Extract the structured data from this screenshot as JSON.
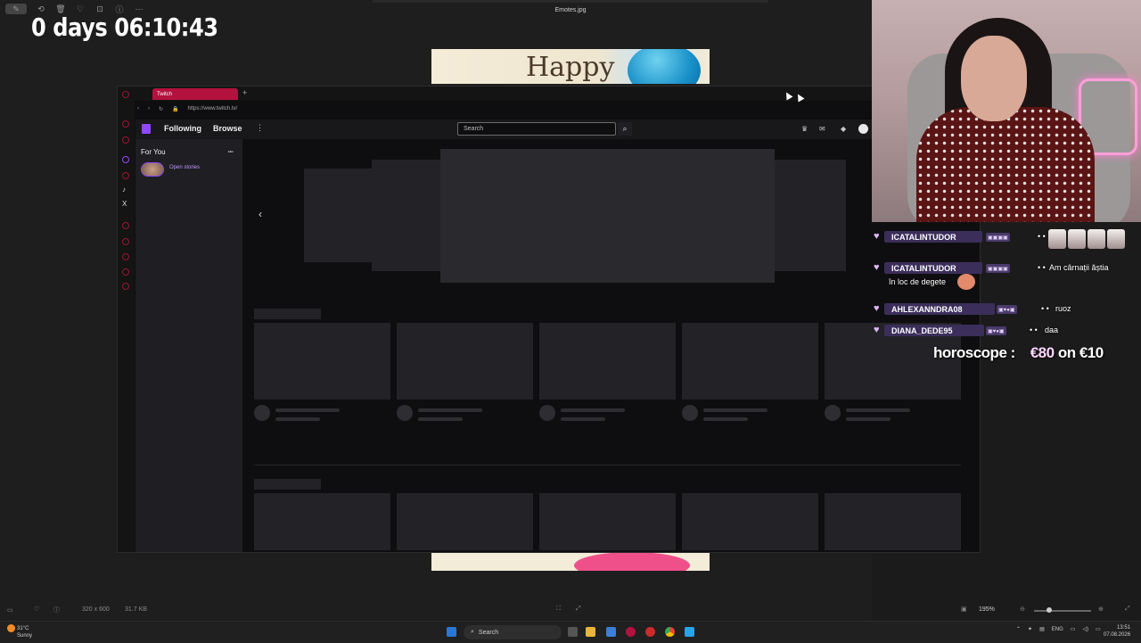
{
  "viewer": {
    "filename": "Emotes.jpg",
    "image_text": "Happy",
    "bottom": {
      "dimensions": "320 x 600",
      "filesize": "31.7 KB",
      "zoom": "195%"
    }
  },
  "stream": {
    "timer": "0 days 06:10:43",
    "horoscope": {
      "label": "horoscope :",
      "current": "€80",
      "sep": "on",
      "goal": "€10"
    }
  },
  "browser": {
    "tab_title": "Twitch",
    "url": "https://www.twitch.tv/",
    "nav": {
      "following": "Following",
      "browse": "Browse",
      "more": "⋮"
    },
    "search_placeholder": "Search",
    "sidebar": {
      "for_you": "For You",
      "open_stories": "Open stories",
      "collapse": "⭰"
    },
    "carousel_prev": "‹"
  },
  "chat": {
    "messages": [
      {
        "user": "ICATALINTUDOR",
        "text": ""
      },
      {
        "user": "ICATALINTUDOR",
        "text": "Am cârnații ăștia",
        "text2": "în loc de degete"
      },
      {
        "user": "AHLEXANNDRA08",
        "text": "ruoz"
      },
      {
        "user": "DIANA_DEDE95",
        "text": "daa"
      }
    ]
  },
  "taskbar": {
    "weather_temp": "31°C",
    "weather_desc": "Sunny",
    "search": "Search",
    "lang": "ENG",
    "time": "13:51",
    "date": "07.08.2026"
  },
  "colors": {
    "twitch_purple": "#9147ff",
    "tab_red": "#b3123e",
    "chat_name_bg": "#3b2e5a"
  }
}
